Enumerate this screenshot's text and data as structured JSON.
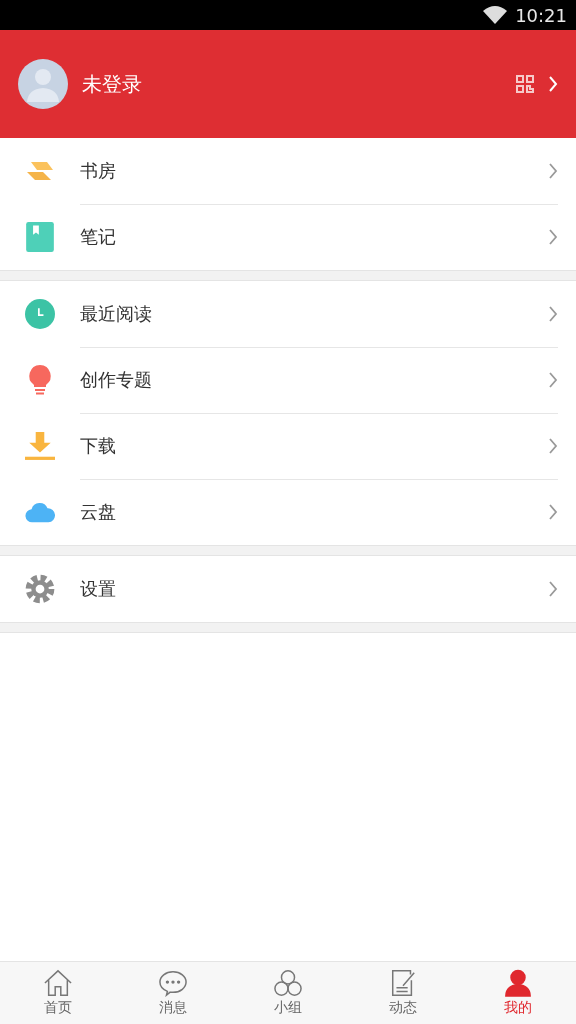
{
  "status_bar": {
    "time": "10:21"
  },
  "profile": {
    "name": "未登录"
  },
  "menu_groups": [
    [
      {
        "kind": "shelf",
        "label": "书房"
      },
      {
        "kind": "note",
        "label": "笔记"
      }
    ],
    [
      {
        "kind": "clock",
        "label": "最近阅读"
      },
      {
        "kind": "bulb",
        "label": "创作专题"
      },
      {
        "kind": "download",
        "label": "下载"
      },
      {
        "kind": "cloud",
        "label": "云盘"
      }
    ],
    [
      {
        "kind": "gear",
        "label": "设置"
      }
    ]
  ],
  "tab_bar": [
    {
      "kind": "home",
      "label": "首页",
      "selected": false
    },
    {
      "kind": "message",
      "label": "消息",
      "selected": false
    },
    {
      "kind": "group",
      "label": "小组",
      "selected": false
    },
    {
      "kind": "feed",
      "label": "动态",
      "selected": false
    },
    {
      "kind": "me",
      "label": "我的",
      "selected": true
    }
  ]
}
